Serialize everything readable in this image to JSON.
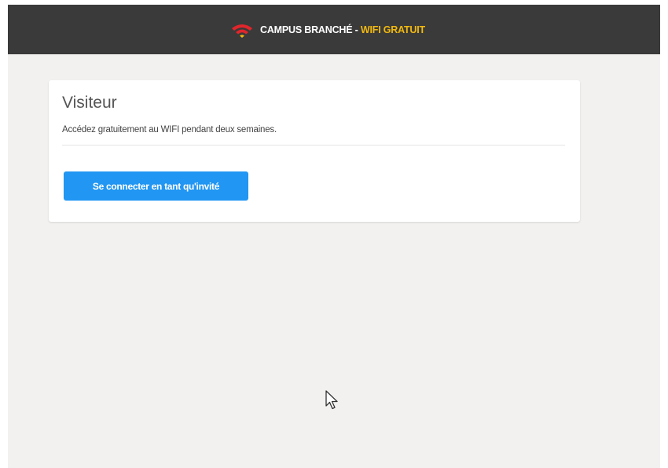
{
  "header": {
    "brand_name": "CAMPUS BRANCHÉ",
    "separator": "-",
    "highlight": "WIFI GRATUIT",
    "logo_icon": "wifi-icon",
    "background_color": "#3a3a3a",
    "accent_color": "#f2b90f"
  },
  "card": {
    "title": "Visiteur",
    "description": "Accédez gratuitement au WIFI pendant deux semaines.",
    "button_label": "Se connecter en tant qu'invité",
    "button_color": "#2196f3"
  },
  "page": {
    "background_color": "#f2f1ef"
  }
}
